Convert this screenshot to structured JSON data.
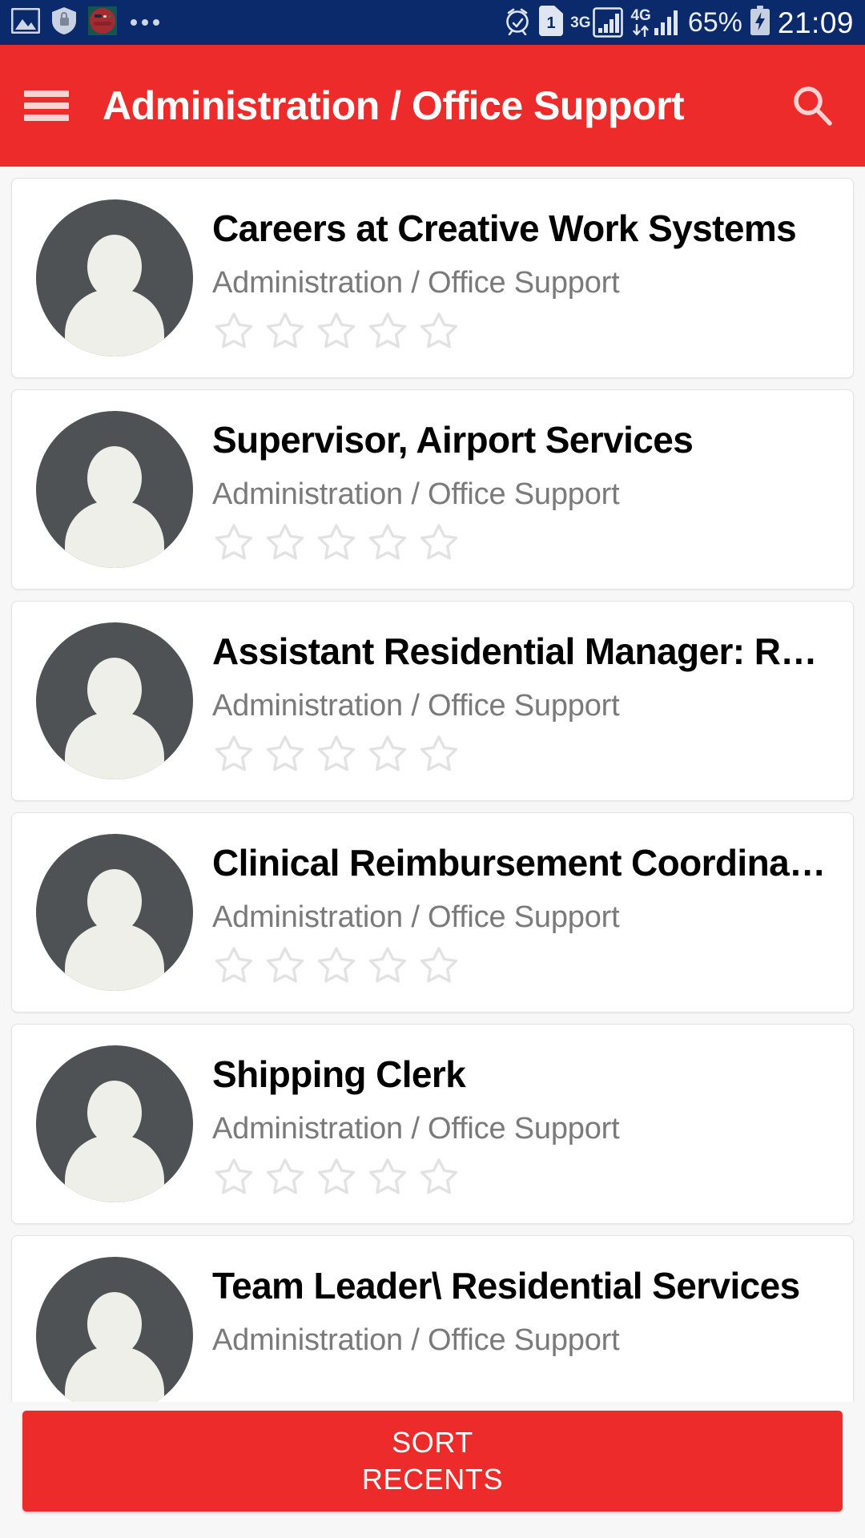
{
  "status_bar": {
    "left_icons": [
      "image-icon",
      "shield-icon",
      "app-badge-icon",
      "overflow-dots-icon"
    ],
    "alarm_icon": "alarm-clock-icon",
    "sim_label": "1",
    "network_1": "3G",
    "network_2": "4G",
    "battery_percent": "65%",
    "battery_icon": "charging-battery-icon",
    "clock": "21:09",
    "background_color": "#0b2a6b"
  },
  "app_bar": {
    "menu_icon": "hamburger-menu-icon",
    "title": "Administration / Office Support",
    "search_icon": "search-icon",
    "background_color": "#ee2b2b",
    "text_color": "#ffffff"
  },
  "list": {
    "items": [
      {
        "title": "Careers at Creative Work Systems",
        "subtitle": "Administration / Office Support",
        "rating": 0,
        "max_rating": 5,
        "avatar_icon": "person-placeholder-icon"
      },
      {
        "title": "Supervisor, Airport Services",
        "subtitle": "Administration / Office Support",
        "rating": 0,
        "max_rating": 5,
        "avatar_icon": "person-placeholder-icon"
      },
      {
        "title": "Assistant Residential Manager: R…",
        "subtitle": "Administration / Office Support",
        "rating": 0,
        "max_rating": 5,
        "avatar_icon": "person-placeholder-icon"
      },
      {
        "title": "Clinical Reimbursement Coordina…",
        "subtitle": "Administration / Office Support",
        "rating": 0,
        "max_rating": 5,
        "avatar_icon": "person-placeholder-icon"
      },
      {
        "title": "Shipping Clerk",
        "subtitle": "Administration / Office Support",
        "rating": 0,
        "max_rating": 5,
        "avatar_icon": "person-placeholder-icon"
      },
      {
        "title": "Team Leader\\ Residential Services",
        "subtitle": "Administration / Office Support",
        "rating": 0,
        "max_rating": 5,
        "avatar_icon": "person-placeholder-icon"
      }
    ]
  },
  "bottom_bar": {
    "sort_line1": "SORT",
    "sort_line2": "RECENTS",
    "button_color": "#ee2b2b"
  }
}
